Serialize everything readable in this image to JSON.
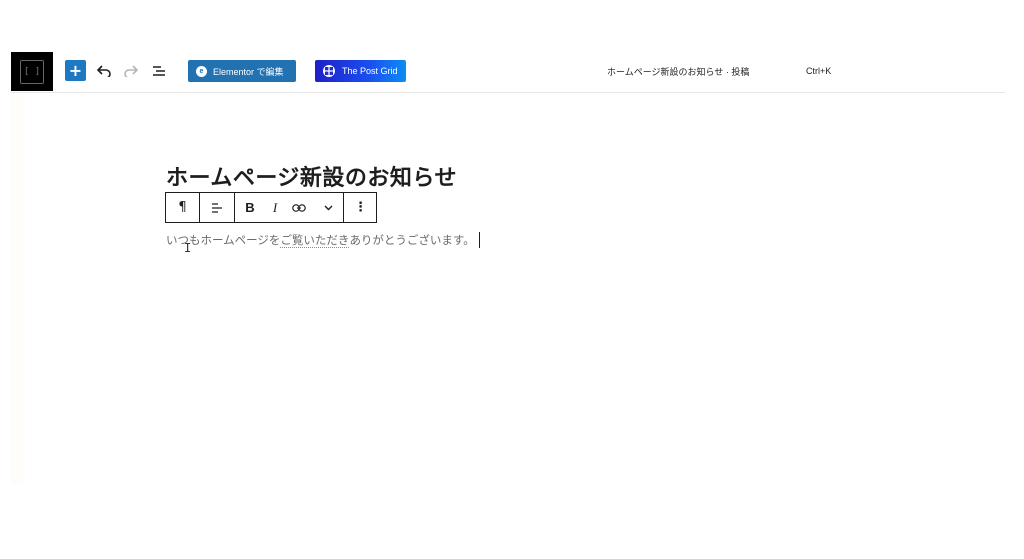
{
  "toolbar": {
    "logo_text": "[ ]",
    "add_label": "+",
    "elementor_badge": "e",
    "elementor_label": "Elementor で編集",
    "postgrid_label": "The Post Grid",
    "document_title": "ホームページ新設のお知らせ · 投稿",
    "shortcut": "Ctrl+K"
  },
  "icons": {
    "undo": "undo-icon",
    "redo": "redo-icon",
    "list_view": "list-view-icon",
    "paragraph": "pilcrow-icon",
    "align": "align-left-icon",
    "link": "link-icon",
    "more_chevron": "chevron-down-icon",
    "options": "vertical-ellipsis-icon"
  },
  "block_toolbar": {
    "paragraph_symbol": "¶",
    "bold": "B",
    "italic": "I",
    "options_symbol": "⋮"
  },
  "post": {
    "title": "ホームページ新設のお知らせ",
    "paragraph_before": "いつもホームページを",
    "paragraph_marked": "ご覧いただき",
    "paragraph_after": "ありがとうございます。"
  },
  "colors": {
    "primary_blue": "#2271b1",
    "add_button": "#1e78c2",
    "postgrid_gradient_start": "#1f1fc9",
    "postgrid_gradient_end": "#0b8df5"
  }
}
